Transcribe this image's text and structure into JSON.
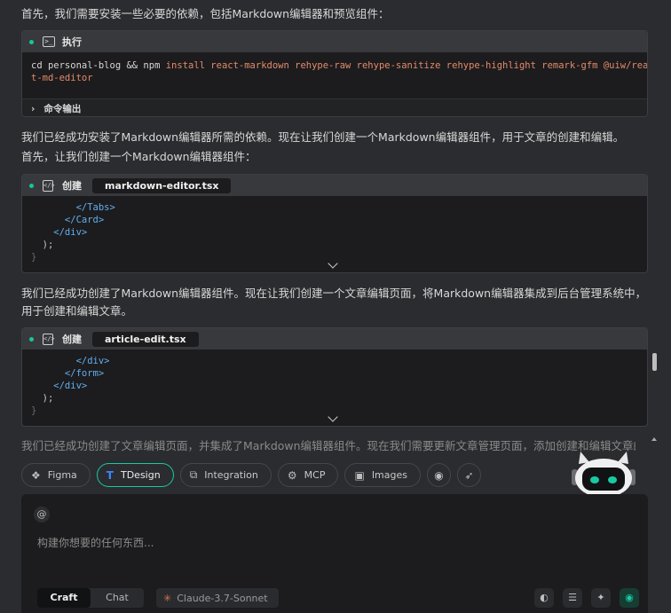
{
  "intro_text": "首先，我们需要安装一些必要的依赖，包括Markdown编辑器和预览组件：",
  "exec_card": {
    "label": "执行",
    "command_lead": "cd personal-blog && npm",
    "command_args": " install react-markdown rehype-raw rehype-sanitize rehype-highlight remark-gfm @uiw/reac",
    "command_wrap": "t-md-editor",
    "output_label": "命令输出"
  },
  "para_after_install": "我们已经成功安装了Markdown编辑器所需的依赖。现在让我们创建一个Markdown编辑器组件，用于文章的创建和编辑。",
  "para_first_create": "首先，让我们创建一个Markdown编辑器组件：",
  "create_card_1": {
    "label": "创建",
    "file": "markdown-editor.tsx",
    "lines": [
      "        </Tabs>",
      "      </Card>",
      "    </div>",
      "  );",
      "}"
    ]
  },
  "para_after_editor": "我们已经成功创建了Markdown编辑器组件。现在让我们创建一个文章编辑页面，将Markdown编辑器集成到后台管理系统中，用于创建和编辑文章。",
  "create_card_2": {
    "label": "创建",
    "file": "article-edit.tsx",
    "lines": [
      "        </div>",
      "      </form>",
      "    </div>",
      "  );",
      "}"
    ]
  },
  "para_faded": "我们已经成功创建了文章编辑页面，并集成了Markdown编辑器组件。现在我们需要更新文章管理页面，添加创建和编辑文章的链",
  "chips": [
    {
      "label": "Figma",
      "icon": "figma-icon",
      "glyph": "❖"
    },
    {
      "label": "TDesign",
      "icon": "tdesign-icon",
      "glyph": "T"
    },
    {
      "label": "Integration",
      "icon": "integration-icon",
      "glyph": "⧉"
    },
    {
      "label": "MCP",
      "icon": "mcp-icon",
      "glyph": "⚙"
    },
    {
      "label": "Images",
      "icon": "image-icon",
      "glyph": "▣"
    }
  ],
  "input": {
    "at_symbol": "@",
    "placeholder": "构建你想要的任何东西..."
  },
  "modes": [
    "Craft",
    "Chat"
  ],
  "model": "Claude-3.7-Sonnet",
  "accent": "#19c9a4"
}
